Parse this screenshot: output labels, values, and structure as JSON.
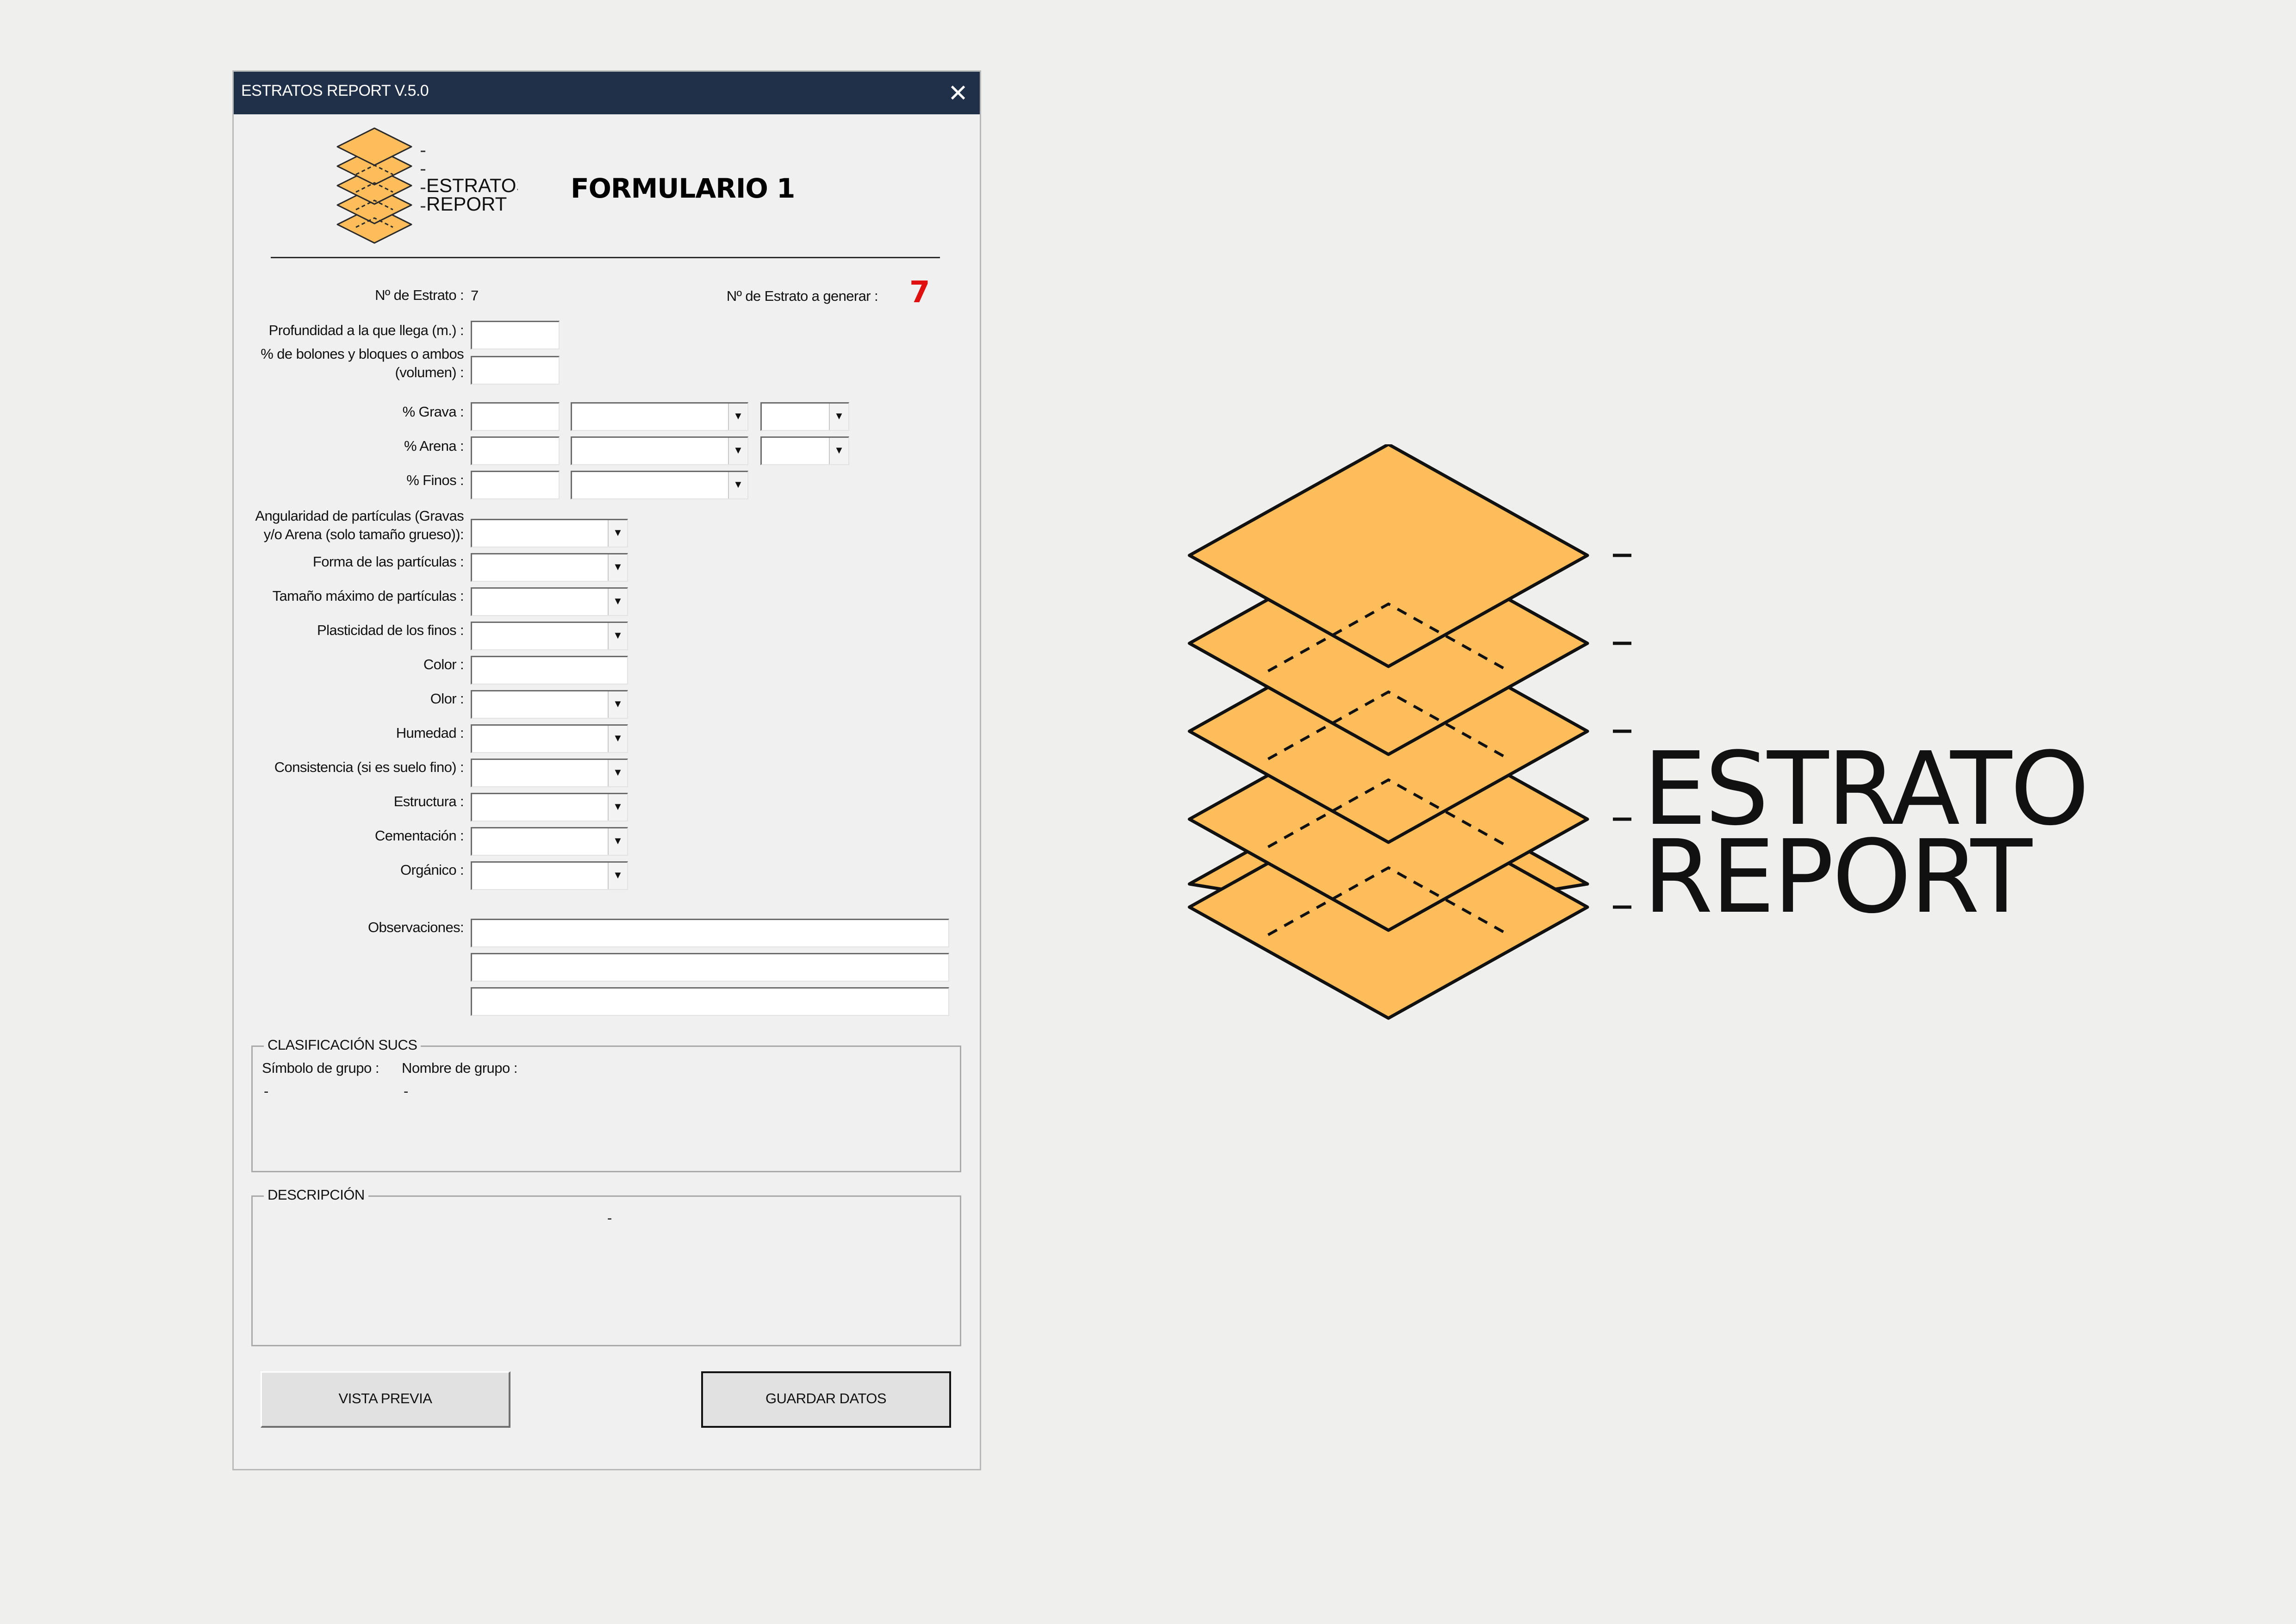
{
  "window": {
    "title": "ESTRATOS REPORT V.5.0",
    "close_glyph": "✕"
  },
  "logo": {
    "line1": "ESTRATOS",
    "line2": "REPORT",
    "fill_color": "#fdbd5a"
  },
  "header": {
    "form_title": "FORMULARIO 1"
  },
  "estrato": {
    "label": "Nº de Estrato :",
    "value": "7",
    "generate_label": "Nº de Estrato a generar :",
    "generate_value": "7",
    "generate_color": "#e01010"
  },
  "fields": {
    "profundidad": "Profundidad a la que llega (m.) :",
    "bolones": "% de bolones y bloques o ambos (volumen) :",
    "grava": "% Grava :",
    "arena": "% Arena :",
    "finos": "% Finos :",
    "angularidad": "Angularidad de partículas (Gravas y/o Arena (solo tamaño grueso)):",
    "forma": "Forma de las partículas :",
    "tamano": "Tamaño máximo de partículas :",
    "plasticidad": "Plasticidad de los finos :",
    "color": "Color :",
    "olor": "Olor :",
    "humedad": "Humedad :",
    "consistencia": "Consistencia (si es suelo fino) :",
    "estructura": "Estructura :",
    "cementacion": "Cementación :",
    "organico": "Orgánico :",
    "observaciones": "Observaciones:"
  },
  "clasificacion": {
    "title": "CLASIFICACIÓN SUCS",
    "simbolo_label": "Símbolo de grupo :",
    "simbolo_value": "-",
    "nombre_label": "Nombre de grupo :",
    "nombre_value": "-"
  },
  "descripcion": {
    "title": "DESCRIPCIÓN",
    "value": "-"
  },
  "buttons": {
    "preview": "VISTA PREVIA",
    "save": "GUARDAR DATOS"
  },
  "icons": {
    "close": "close-icon",
    "dropdown": "chevron-down-icon"
  }
}
